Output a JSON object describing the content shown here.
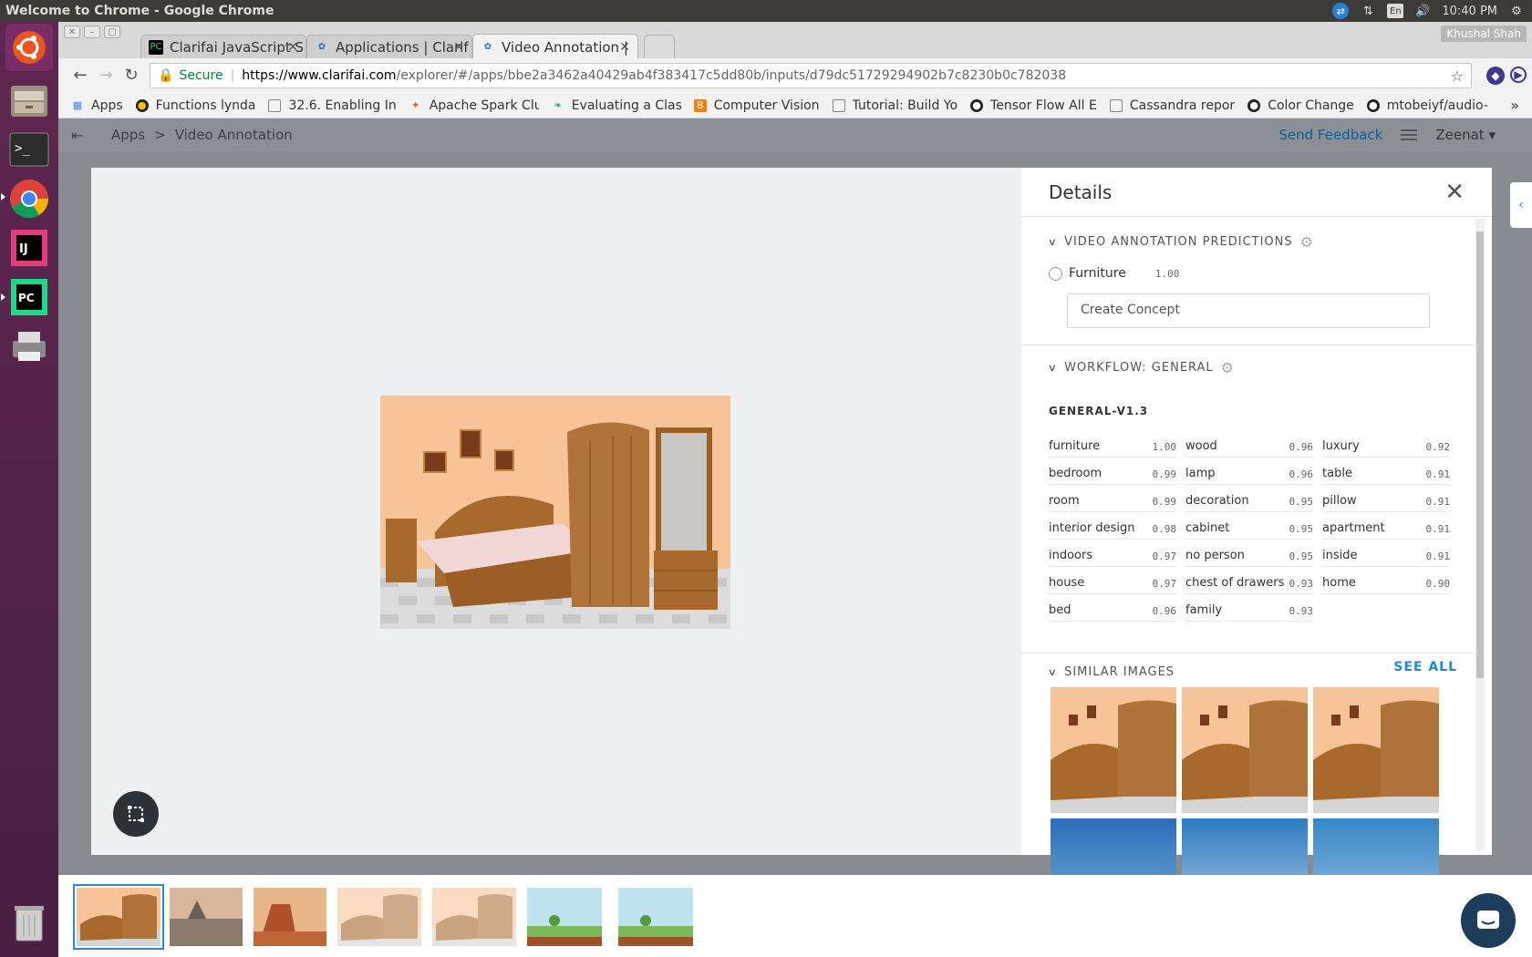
{
  "os": {
    "window_title": "Welcome to Chrome - Google Chrome",
    "keyboard_layout": "En",
    "time": "10:40 PM"
  },
  "browser": {
    "profile_name": "Khushal Shah",
    "tabs": [
      {
        "title": "Clarifai JavaScript S",
        "icon": "pycharm-icon"
      },
      {
        "title": "Applications | Clarif",
        "icon": "clarifai-icon"
      },
      {
        "title": "Video Annotation |",
        "icon": "clarifai-icon",
        "active": true
      }
    ],
    "address": {
      "secure_label": "Secure",
      "host": "https://www.clarifai.com",
      "path": "/explorer/#/apps/bbe2a3462a40429ab4f383417c5dd80b/inputs/d79dc51729294902b7c8230b0c782038"
    },
    "bookmarks": [
      {
        "label": "Apps",
        "icon": "apps-grid-icon"
      },
      {
        "label": "Functions lynda",
        "icon": "lynda-icon"
      },
      {
        "label": "32.6. Enabling In",
        "icon": "page-icon"
      },
      {
        "label": "Apache Spark Clu",
        "icon": "spark-icon"
      },
      {
        "label": "Evaluating a Clas",
        "icon": "leaf-icon"
      },
      {
        "label": "Computer Vision",
        "icon": "blogger-icon"
      },
      {
        "label": "Tutorial: Build Yo",
        "icon": "page-icon"
      },
      {
        "label": "Tensor Flow All E",
        "icon": "github-icon"
      },
      {
        "label": "Cassandra repor",
        "icon": "page-icon"
      },
      {
        "label": "Color Change",
        "icon": "github-icon"
      },
      {
        "label": "mtobeiyf/audio-",
        "icon": "github-icon"
      }
    ],
    "more_bookmarks": "»"
  },
  "app": {
    "breadcrumbs": [
      "Apps",
      "Video Annotation"
    ],
    "breadcrumb_sep": ">",
    "send_feedback": "Send Feedback",
    "user": "Zeenat"
  },
  "details": {
    "title": "Details",
    "close": "✕",
    "predictions": {
      "title": "VIDEO ANNOTATION PREDICTIONS",
      "concept": "Furniture",
      "value": "1.00",
      "create_placeholder": "Create Concept"
    },
    "workflow": {
      "title": "WORKFLOW: GENERAL",
      "model": "GENERAL-V1.3",
      "tags": [
        {
          "name": "furniture",
          "value": "1.00"
        },
        {
          "name": "wood",
          "value": "0.96"
        },
        {
          "name": "luxury",
          "value": "0.92"
        },
        {
          "name": "bedroom",
          "value": "0.99"
        },
        {
          "name": "lamp",
          "value": "0.96"
        },
        {
          "name": "table",
          "value": "0.91"
        },
        {
          "name": "room",
          "value": "0.99"
        },
        {
          "name": "decoration",
          "value": "0.95"
        },
        {
          "name": "pillow",
          "value": "0.91"
        },
        {
          "name": "interior design",
          "value": "0.98"
        },
        {
          "name": "cabinet",
          "value": "0.95"
        },
        {
          "name": "apartment",
          "value": "0.91"
        },
        {
          "name": "indoors",
          "value": "0.97"
        },
        {
          "name": "no person",
          "value": "0.95"
        },
        {
          "name": "inside",
          "value": "0.91"
        },
        {
          "name": "house",
          "value": "0.97"
        },
        {
          "name": "chest of drawers",
          "value": "0.93"
        },
        {
          "name": "home",
          "value": "0.90"
        },
        {
          "name": "bed",
          "value": "0.96"
        },
        {
          "name": "family",
          "value": "0.93"
        }
      ]
    },
    "similar": {
      "title": "SIMILAR IMAGES",
      "see_all": "SEE ALL"
    }
  }
}
